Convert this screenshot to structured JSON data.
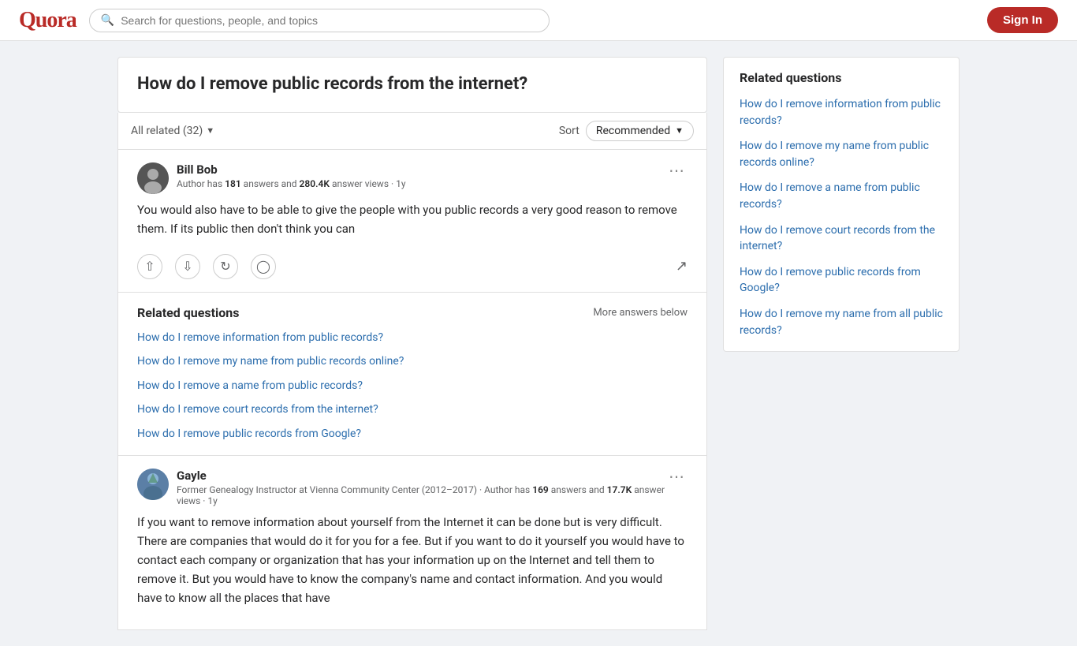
{
  "header": {
    "logo": "Quora",
    "search_placeholder": "Search for questions, people, and topics",
    "sign_in_label": "Sign In"
  },
  "page": {
    "question": "How do I remove public records from the internet?",
    "all_related": "All related (32)",
    "sort_label": "Sort",
    "sort_value": "Recommended"
  },
  "answers": [
    {
      "id": "bill-bob",
      "author_name": "Bill Bob",
      "author_meta_prefix": "Author has ",
      "author_answers": "181",
      "author_meta_mid": " answers and ",
      "author_views": "280.4K",
      "author_meta_suffix": " answer views · 1y",
      "text": "You would also have to be able to give the people with you public records a very good reason to remove them. If its public then don't think you can"
    },
    {
      "id": "gayle",
      "author_name": "Gayle",
      "author_meta_prefix": "Former Genealogy Instructor at Vienna Community Center (2012–2017) · Author has ",
      "author_answers": "169",
      "author_meta_mid": " answers and ",
      "author_views": "17.7K",
      "author_meta_suffix": " answer views · 1y",
      "text": "If you want to remove information about yourself from the Internet it can be done but is very difficult. There are companies that would do it for you for a fee. But if you want to do it yourself you would have to contact each company or organization that has your information up on the Internet and tell them to remove it. But you would have to know the company's name and contact information. And you would have to know all the places that have"
    }
  ],
  "related_inline": {
    "title": "Related questions",
    "more_below": "More answers below",
    "links": [
      "How do I remove information from public records?",
      "How do I remove my name from public records online?",
      "How do I remove a name from public records?",
      "How do I remove court records from the internet?",
      "How do I remove public records from Google?"
    ]
  },
  "sidebar": {
    "title": "Related questions",
    "links": [
      "How do I remove information from public records?",
      "How do I remove my name from public records online?",
      "How do I remove a name from public records?",
      "How do I remove court records from the internet?",
      "How do I remove public records from Google?",
      "How do I remove my name from all public records?"
    ]
  }
}
